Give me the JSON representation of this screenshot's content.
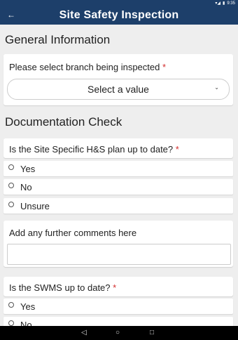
{
  "status": {
    "time": "9:35"
  },
  "appbar": {
    "title": "Site Safety Inspection",
    "back_icon": "arrow-left-icon"
  },
  "sections": [
    {
      "heading": "General Information"
    },
    {
      "heading": "Documentation Check"
    }
  ],
  "branch": {
    "question": "Please select branch being inspected",
    "required_mark": "*",
    "select_value": "Select a value"
  },
  "hs_plan": {
    "question": "Is the Site Specific H&S plan up to date?",
    "required_mark": "*",
    "options": [
      "Yes",
      "No",
      "Unsure"
    ]
  },
  "comments": {
    "label": "Add any further comments here",
    "value": ""
  },
  "swms": {
    "question": "Is the SWMS up to date?",
    "required_mark": "*",
    "options": [
      "Yes",
      "No"
    ]
  },
  "navbar": {
    "back": "◁",
    "home": "○",
    "recents": "□"
  }
}
